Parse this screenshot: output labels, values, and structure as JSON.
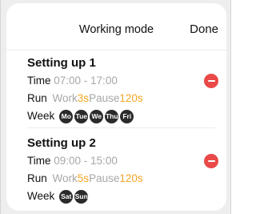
{
  "header": {
    "title": "Working mode",
    "done_label": "Done"
  },
  "entries": [
    {
      "title": "Setting up 1",
      "time_label": "Time",
      "time_value": "07:00 - 17:00",
      "run_label": "Run",
      "work_label": "Work",
      "work_value": "3s",
      "pause_label": "Pause",
      "pause_value": "120s",
      "week_label": "Week",
      "days": [
        "Mo",
        "Tue",
        "We",
        "Thu",
        "Fri"
      ]
    },
    {
      "title": "Setting up 2",
      "time_label": "Time",
      "time_value": "09:00 - 15:00",
      "run_label": "Run",
      "work_label": "Work",
      "work_value": "5s",
      "pause_label": "Pause",
      "pause_value": "120s",
      "week_label": "Week",
      "days": [
        "Sat",
        "Sun"
      ]
    }
  ],
  "colors": {
    "accent": "#f5a623",
    "muted": "#a7a7a7",
    "day_pill": "#2a2a2a",
    "remove": "#ea4949"
  },
  "icons": {
    "remove": "minus-circle-icon"
  }
}
